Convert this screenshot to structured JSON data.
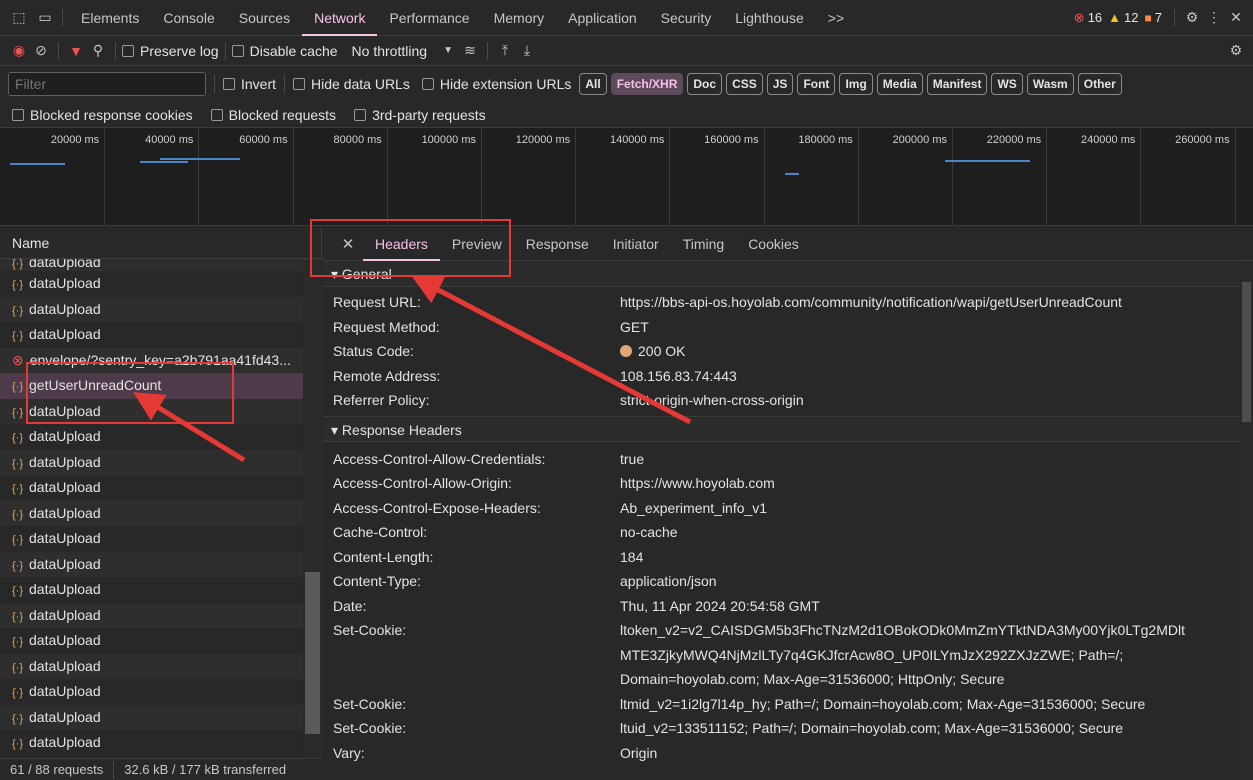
{
  "topbar": {
    "tabs": [
      "Elements",
      "Console",
      "Sources",
      "Network",
      "Performance",
      "Memory",
      "Application",
      "Security",
      "Lighthouse"
    ],
    "active_tab": "Network",
    "more": ">>",
    "errors": "16",
    "warnings": "12",
    "issues": "7"
  },
  "toolbar": {
    "preserve_log": "Preserve log",
    "disable_cache": "Disable cache",
    "throttling": "No throttling"
  },
  "filter": {
    "placeholder": "Filter",
    "invert": "Invert",
    "hide_data_urls": "Hide data URLs",
    "hide_extension_urls": "Hide extension URLs",
    "types": [
      "All",
      "Fetch/XHR",
      "Doc",
      "CSS",
      "JS",
      "Font",
      "Img",
      "Media",
      "Manifest",
      "WS",
      "Wasm",
      "Other"
    ],
    "active_type": "Fetch/XHR"
  },
  "blocked": {
    "cookies": "Blocked response cookies",
    "requests": "Blocked requests",
    "third_party": "3rd-party requests"
  },
  "timeline": {
    "ticks": [
      "20000 ms",
      "40000 ms",
      "60000 ms",
      "80000 ms",
      "100000 ms",
      "120000 ms",
      "140000 ms",
      "160000 ms",
      "180000 ms",
      "200000 ms",
      "220000 ms",
      "240000 ms",
      "260000 ms"
    ]
  },
  "list": {
    "header": "Name",
    "partial_top": "dataUpload",
    "items": [
      {
        "name": "dataUpload",
        "type": "xhr"
      },
      {
        "name": "dataUpload",
        "type": "xhr"
      },
      {
        "name": "dataUpload",
        "type": "xhr"
      },
      {
        "name": "envelope/?sentry_key=a2b791aa41fd43...",
        "type": "error"
      },
      {
        "name": "getUserUnreadCount",
        "type": "xhr",
        "selected": true
      },
      {
        "name": "dataUpload",
        "type": "xhr"
      },
      {
        "name": "dataUpload",
        "type": "xhr"
      },
      {
        "name": "dataUpload",
        "type": "xhr"
      },
      {
        "name": "dataUpload",
        "type": "xhr"
      },
      {
        "name": "dataUpload",
        "type": "xhr"
      },
      {
        "name": "dataUpload",
        "type": "xhr"
      },
      {
        "name": "dataUpload",
        "type": "xhr"
      },
      {
        "name": "dataUpload",
        "type": "xhr"
      },
      {
        "name": "dataUpload",
        "type": "xhr"
      },
      {
        "name": "dataUpload",
        "type": "xhr"
      },
      {
        "name": "dataUpload",
        "type": "xhr"
      },
      {
        "name": "dataUpload",
        "type": "xhr"
      },
      {
        "name": "dataUpload",
        "type": "xhr"
      },
      {
        "name": "dataUpload",
        "type": "xhr"
      }
    ]
  },
  "status": {
    "requests": "61 / 88 requests",
    "transferred": "32.6 kB / 177 kB transferred"
  },
  "details": {
    "tabs": [
      "Headers",
      "Preview",
      "Response",
      "Initiator",
      "Timing",
      "Cookies"
    ],
    "active_tab": "Headers",
    "general_title": "▾ General",
    "general": [
      {
        "k": "Request URL:",
        "v": "https://bbs-api-os.hoyolab.com/community/notification/wapi/getUserUnreadCount"
      },
      {
        "k": "Request Method:",
        "v": "GET"
      },
      {
        "k": "Status Code:",
        "v": "200 OK"
      },
      {
        "k": "Remote Address:",
        "v": "108.156.83.74:443"
      },
      {
        "k": "Referrer Policy:",
        "v": "strict-origin-when-cross-origin"
      }
    ],
    "response_title": "▾ Response Headers",
    "response": [
      {
        "k": "Access-Control-Allow-Credentials:",
        "v": "true"
      },
      {
        "k": "Access-Control-Allow-Origin:",
        "v": "https://www.hoyolab.com"
      },
      {
        "k": "Access-Control-Expose-Headers:",
        "v": "Ab_experiment_info_v1"
      },
      {
        "k": "Cache-Control:",
        "v": "no-cache"
      },
      {
        "k": "Content-Length:",
        "v": "184"
      },
      {
        "k": "Content-Type:",
        "v": "application/json"
      },
      {
        "k": "Date:",
        "v": "Thu, 11 Apr 2024 20:54:58 GMT"
      },
      {
        "k": "Set-Cookie:",
        "v": "ltoken_v2=v2_CAISDGM5b3FhcTNzM2d1OBokODk0MmZmYTktNDA3My00Yjk0LTg2MDlt"
      },
      {
        "k": "",
        "v": "MTE3ZjkyMWQ4NjMzlLTy7q4GKJfcrAcw8O_UP0ILYmJzX292ZXJzZWE; Path=/;"
      },
      {
        "k": "",
        "v": "Domain=hoyolab.com; Max-Age=31536000; HttpOnly; Secure"
      },
      {
        "k": "Set-Cookie:",
        "v": "ltmid_v2=1i2lg7l14p_hy; Path=/; Domain=hoyolab.com; Max-Age=31536000; Secure"
      },
      {
        "k": "Set-Cookie:",
        "v": "ltuid_v2=133511152; Path=/; Domain=hoyolab.com; Max-Age=31536000; Secure"
      },
      {
        "k": "Vary:",
        "v": "Origin"
      }
    ]
  },
  "icons": {
    "xhr": "{·}",
    "close": "✕",
    "settings": "⚙"
  },
  "colors": {
    "accent": "#f5c2e7",
    "annotation": "#e53935",
    "error": "#ef5350",
    "warning": "#fbc02d"
  }
}
